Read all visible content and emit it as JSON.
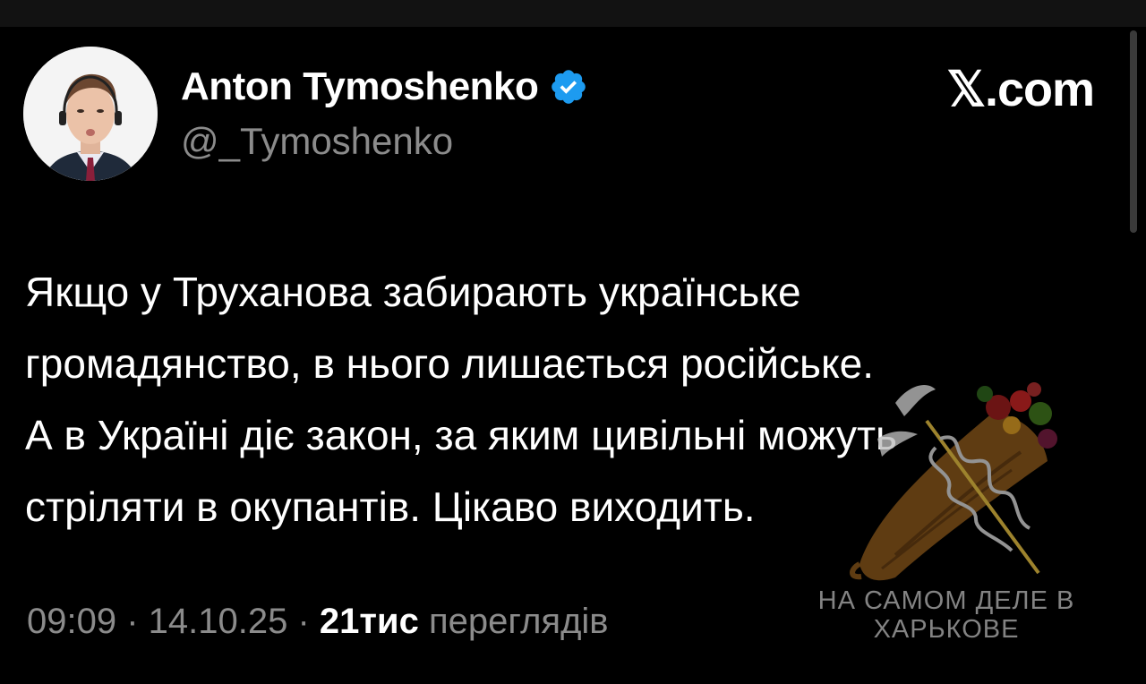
{
  "author": {
    "name": "Anton Tymoshenko",
    "handle": "@_Tymoshenko",
    "verified": true
  },
  "brand": {
    "site_label": "𝕏.com"
  },
  "tweet": {
    "text": "Якщо у Труханова забирають українське\nгромадянство, в нього лишається російське.\nА в Україні діє закон, за яким цивільні можуть\nстріляти в окупантів. Цікаво виходить."
  },
  "meta": {
    "time": "09:09",
    "separator": " · ",
    "date": "14.10.25",
    "views_count": "21тис",
    "views_label": "переглядів"
  },
  "watermark": {
    "line1": "НА САМОМ ДЕЛЕ В",
    "line2": "ХАРЬКОВЕ"
  },
  "colors": {
    "background": "#000000",
    "text_primary": "#ffffff",
    "text_secondary": "#8b8b8b",
    "verified_badge": "#1d9bf0"
  },
  "icons": {
    "verified": "verified-badge-icon",
    "watermark": "cornucopia-caduceus-logo"
  }
}
